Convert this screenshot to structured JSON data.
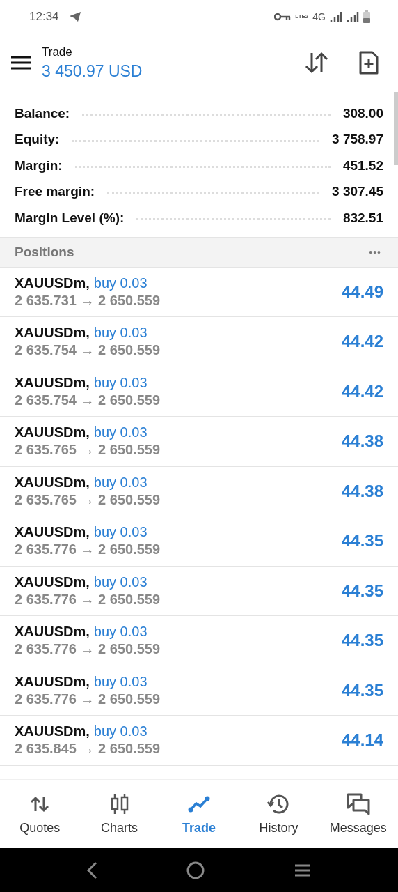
{
  "status_bar": {
    "time": "12:34",
    "volte": "LTE2",
    "network": "4G"
  },
  "header": {
    "title": "Trade",
    "balance": "3 450.97 USD"
  },
  "summary": [
    {
      "label": "Balance:",
      "value": "308.00"
    },
    {
      "label": "Equity:",
      "value": "3 758.97"
    },
    {
      "label": "Margin:",
      "value": "451.52"
    },
    {
      "label": "Free margin:",
      "value": "3 307.45"
    },
    {
      "label": "Margin Level (%):",
      "value": "832.51"
    }
  ],
  "positions": {
    "title": "Positions",
    "more": "•••",
    "rows": [
      {
        "symbol": "XAUUSDm,",
        "side": "buy 0.03",
        "prices": "2 635.731 → 2 650.559",
        "profit": "44.49"
      },
      {
        "symbol": "XAUUSDm,",
        "side": "buy 0.03",
        "prices": "2 635.754 → 2 650.559",
        "profit": "44.42"
      },
      {
        "symbol": "XAUUSDm,",
        "side": "buy 0.03",
        "prices": "2 635.754 → 2 650.559",
        "profit": "44.42"
      },
      {
        "symbol": "XAUUSDm,",
        "side": "buy 0.03",
        "prices": "2 635.765 → 2 650.559",
        "profit": "44.38"
      },
      {
        "symbol": "XAUUSDm,",
        "side": "buy 0.03",
        "prices": "2 635.765 → 2 650.559",
        "profit": "44.38"
      },
      {
        "symbol": "XAUUSDm,",
        "side": "buy 0.03",
        "prices": "2 635.776 → 2 650.559",
        "profit": "44.35"
      },
      {
        "symbol": "XAUUSDm,",
        "side": "buy 0.03",
        "prices": "2 635.776 → 2 650.559",
        "profit": "44.35"
      },
      {
        "symbol": "XAUUSDm,",
        "side": "buy 0.03",
        "prices": "2 635.776 → 2 650.559",
        "profit": "44.35"
      },
      {
        "symbol": "XAUUSDm,",
        "side": "buy 0.03",
        "prices": "2 635.776 → 2 650.559",
        "profit": "44.35"
      },
      {
        "symbol": "XAUUSDm,",
        "side": "buy 0.03",
        "prices": "2 635.845 → 2 650.559",
        "profit": "44.14"
      }
    ]
  },
  "nav": [
    {
      "label": "Quotes",
      "selected": false
    },
    {
      "label": "Charts",
      "selected": false
    },
    {
      "label": "Trade",
      "selected": true
    },
    {
      "label": "History",
      "selected": false
    },
    {
      "label": "Messages",
      "selected": false
    }
  ]
}
